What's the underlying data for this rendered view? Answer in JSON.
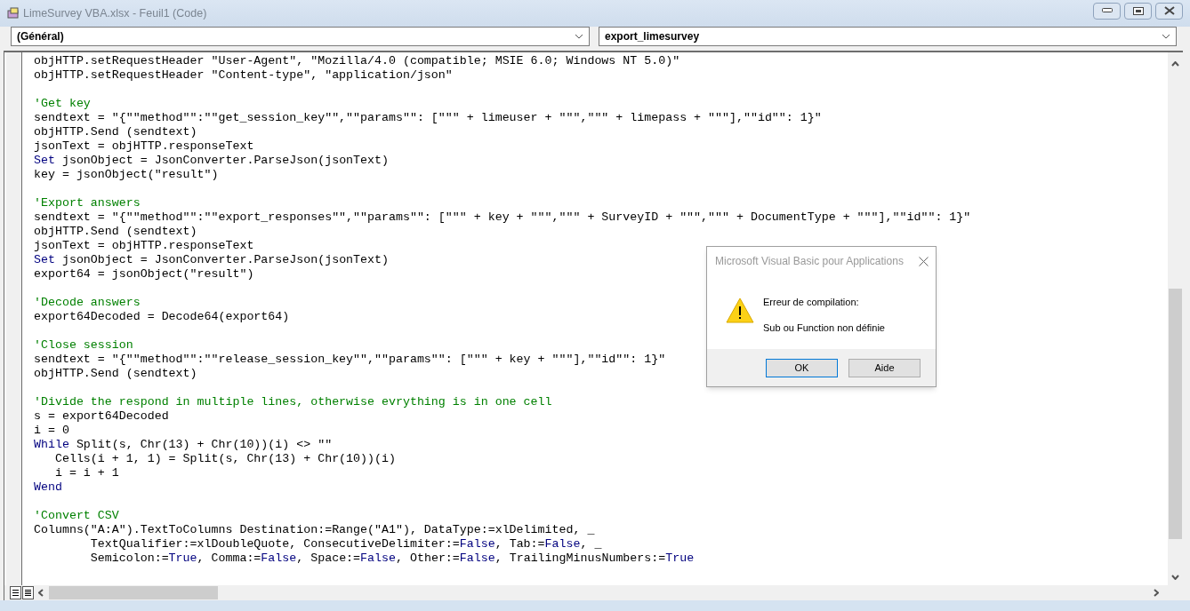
{
  "window": {
    "title": "LimeSurvey VBA.xlsx - Feuil1 (Code)"
  },
  "object_dropdown": {
    "value": "(Général)"
  },
  "procedure_dropdown": {
    "value": "export_limesurvey"
  },
  "code_lines": [
    {
      "kind": "code",
      "segments": [
        {
          "kind": "plain",
          "text": "objHTTP.setRequestHeader \"User-Agent\", \"Mozilla/4.0 (compatible; MSIE 6.0; Windows NT 5.0)\""
        }
      ]
    },
    {
      "kind": "code",
      "segments": [
        {
          "kind": "plain",
          "text": "objHTTP.setRequestHeader \"Content-type\", \"application/json\""
        }
      ]
    },
    {
      "kind": "blank"
    },
    {
      "kind": "code",
      "segments": [
        {
          "kind": "comment",
          "text": "'Get key"
        }
      ]
    },
    {
      "kind": "code",
      "segments": [
        {
          "kind": "plain",
          "text": "sendtext = \"{\"\"method\"\":\"\"get_session_key\"\",\"\"params\"\": [\"\"\" + limeuser + \"\"\",\"\"\" + limepass + \"\"\"],\"\"id\"\": 1}\""
        }
      ]
    },
    {
      "kind": "code",
      "segments": [
        {
          "kind": "plain",
          "text": "objHTTP.Send (sendtext)"
        }
      ]
    },
    {
      "kind": "code",
      "segments": [
        {
          "kind": "plain",
          "text": "jsonText = objHTTP.responseText"
        }
      ]
    },
    {
      "kind": "code",
      "segments": [
        {
          "kind": "keyword",
          "text": "Set"
        },
        {
          "kind": "plain",
          "text": " jsonObject = JsonConverter.ParseJson(jsonText)"
        }
      ]
    },
    {
      "kind": "code",
      "segments": [
        {
          "kind": "plain",
          "text": "key = jsonObject(\"result\")"
        }
      ]
    },
    {
      "kind": "blank"
    },
    {
      "kind": "code",
      "segments": [
        {
          "kind": "comment",
          "text": "'Export answers"
        }
      ]
    },
    {
      "kind": "code",
      "segments": [
        {
          "kind": "plain",
          "text": "sendtext = \"{\"\"method\"\":\"\"export_responses\"\",\"\"params\"\": [\"\"\" + key + \"\"\",\"\"\" + SurveyID + \"\"\",\"\"\" + DocumentType + \"\"\"],\"\"id\"\": 1}\""
        }
      ]
    },
    {
      "kind": "code",
      "segments": [
        {
          "kind": "plain",
          "text": "objHTTP.Send (sendtext)"
        }
      ]
    },
    {
      "kind": "code",
      "segments": [
        {
          "kind": "plain",
          "text": "jsonText = objHTTP.responseText"
        }
      ]
    },
    {
      "kind": "code",
      "segments": [
        {
          "kind": "keyword",
          "text": "Set"
        },
        {
          "kind": "plain",
          "text": " jsonObject = JsonConverter.ParseJson(jsonText)"
        }
      ]
    },
    {
      "kind": "code",
      "segments": [
        {
          "kind": "plain",
          "text": "export64 = jsonObject(\"result\")"
        }
      ]
    },
    {
      "kind": "blank"
    },
    {
      "kind": "code",
      "segments": [
        {
          "kind": "comment",
          "text": "'Decode answers"
        }
      ]
    },
    {
      "kind": "code",
      "segments": [
        {
          "kind": "plain",
          "text": "export64Decoded = Decode64(export64)"
        }
      ]
    },
    {
      "kind": "blank"
    },
    {
      "kind": "code",
      "segments": [
        {
          "kind": "comment",
          "text": "'Close session"
        }
      ]
    },
    {
      "kind": "code",
      "segments": [
        {
          "kind": "plain",
          "text": "sendtext = \"{\"\"method\"\":\"\"release_session_key\"\",\"\"params\"\": [\"\"\" + key + \"\"\"],\"\"id\"\": 1}\""
        }
      ]
    },
    {
      "kind": "code",
      "segments": [
        {
          "kind": "plain",
          "text": "objHTTP.Send (sendtext)"
        }
      ]
    },
    {
      "kind": "blank"
    },
    {
      "kind": "code",
      "segments": [
        {
          "kind": "comment",
          "text": "'Divide the respond in multiple lines, otherwise evrything is in one cell"
        }
      ]
    },
    {
      "kind": "code",
      "segments": [
        {
          "kind": "plain",
          "text": "s = export64Decoded"
        }
      ]
    },
    {
      "kind": "code",
      "segments": [
        {
          "kind": "plain",
          "text": "i = 0"
        }
      ]
    },
    {
      "kind": "code",
      "segments": [
        {
          "kind": "keyword",
          "text": "While"
        },
        {
          "kind": "plain",
          "text": " Split(s, Chr(13) + Chr(10))(i) <> \"\""
        }
      ]
    },
    {
      "kind": "code",
      "segments": [
        {
          "kind": "plain",
          "text": "   Cells(i + 1, 1) = Split(s, Chr(13) + Chr(10))(i)"
        }
      ]
    },
    {
      "kind": "code",
      "segments": [
        {
          "kind": "plain",
          "text": "   i = i + 1"
        }
      ]
    },
    {
      "kind": "code",
      "segments": [
        {
          "kind": "keyword",
          "text": "Wend"
        }
      ]
    },
    {
      "kind": "blank"
    },
    {
      "kind": "code",
      "segments": [
        {
          "kind": "comment",
          "text": "'Convert CSV"
        }
      ]
    },
    {
      "kind": "code",
      "segments": [
        {
          "kind": "plain",
          "text": "Columns(\"A:A\").TextToColumns Destination:=Range(\"A1\"), DataType:=xlDelimited, _"
        }
      ]
    },
    {
      "kind": "code",
      "segments": [
        {
          "kind": "plain",
          "text": "        TextQualifier:=xlDoubleQuote, ConsecutiveDelimiter:="
        },
        {
          "kind": "keyword",
          "text": "False"
        },
        {
          "kind": "plain",
          "text": ", Tab:="
        },
        {
          "kind": "keyword",
          "text": "False"
        },
        {
          "kind": "plain",
          "text": ", _"
        }
      ]
    },
    {
      "kind": "code",
      "segments": [
        {
          "kind": "plain",
          "text": "        Semicolon:="
        },
        {
          "kind": "keyword",
          "text": "True"
        },
        {
          "kind": "plain",
          "text": ", Comma:="
        },
        {
          "kind": "keyword",
          "text": "False"
        },
        {
          "kind": "plain",
          "text": ", Space:="
        },
        {
          "kind": "keyword",
          "text": "False"
        },
        {
          "kind": "plain",
          "text": ", Other:="
        },
        {
          "kind": "keyword",
          "text": "False"
        },
        {
          "kind": "plain",
          "text": ", TrailingMinusNumbers:="
        },
        {
          "kind": "keyword",
          "text": "True"
        }
      ]
    }
  ],
  "dialog": {
    "title": "Microsoft Visual Basic pour Applications",
    "heading": "Erreur de compilation:",
    "message": "Sub ou Function non définie",
    "buttons": [
      {
        "label": "OK",
        "default": true
      },
      {
        "label": "Aide",
        "default": false
      }
    ]
  }
}
